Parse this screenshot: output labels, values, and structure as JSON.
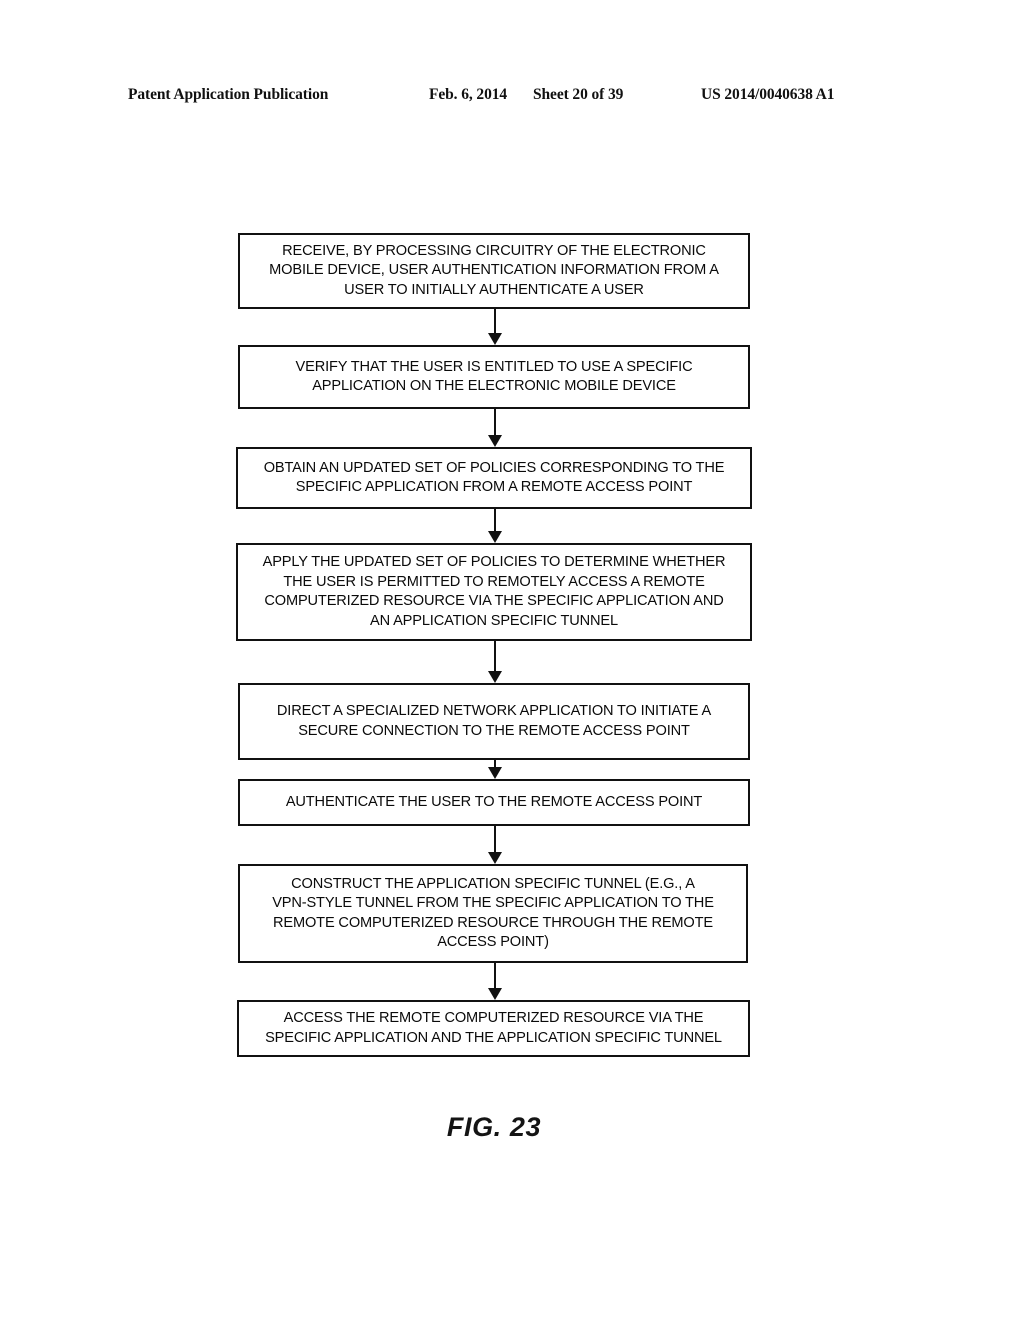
{
  "header": {
    "publication": "Patent Application Publication",
    "date": "Feb. 6, 2014",
    "sheet": "Sheet 20 of 39",
    "document_number": "US 2014/0040638 A1"
  },
  "figure": {
    "caption": "FIG. 23",
    "type": "flowchart",
    "orientation": "vertical-top-to-bottom"
  },
  "flowchart": {
    "steps": [
      {
        "id": "step-receive-authentication-info",
        "text": "RECEIVE, BY PROCESSING CIRCUITRY OF THE ELECTRONIC\nMOBILE DEVICE, USER AUTHENTICATION INFORMATION FROM A\nUSER TO INITIALLY AUTHENTICATE A USER"
      },
      {
        "id": "step-verify-entitlement",
        "text": "VERIFY THAT THE USER IS ENTITLED TO USE A SPECIFIC\nAPPLICATION ON THE ELECTRONIC MOBILE DEVICE"
      },
      {
        "id": "step-obtain-updated-policies",
        "text": "OBTAIN AN UPDATED SET OF POLICIES CORRESPONDING TO THE\nSPECIFIC APPLICATION FROM A REMOTE ACCESS POINT"
      },
      {
        "id": "step-apply-policies",
        "text": "APPLY THE UPDATED SET OF POLICIES TO DETERMINE WHETHER\nTHE USER IS PERMITTED TO REMOTELY ACCESS A REMOTE\nCOMPUTERIZED RESOURCE VIA THE SPECIFIC APPLICATION AND\nAN APPLICATION SPECIFIC TUNNEL"
      },
      {
        "id": "step-direct-network-application",
        "text": "DIRECT A SPECIALIZED NETWORK APPLICATION TO INITIATE A\nSECURE CONNECTION TO THE REMOTE ACCESS POINT"
      },
      {
        "id": "step-authenticate-to-access-point",
        "text": "AUTHENTICATE THE USER TO THE REMOTE ACCESS POINT"
      },
      {
        "id": "step-construct-tunnel",
        "text": "CONSTRUCT THE APPLICATION SPECIFIC TUNNEL (E.G., A\nVPN-STYLE TUNNEL FROM THE SPECIFIC APPLICATION TO THE\nREMOTE COMPUTERIZED RESOURCE THROUGH THE REMOTE\nACCESS POINT)"
      },
      {
        "id": "step-access-resource",
        "text": "ACCESS THE REMOTE COMPUTERIZED RESOURCE VIA THE\nSPECIFIC APPLICATION AND THE APPLICATION SPECIFIC TUNNEL"
      }
    ],
    "connectors": [
      {
        "id": "arrow-1",
        "from": "step-receive-authentication-info",
        "to": "step-verify-entitlement"
      },
      {
        "id": "arrow-2",
        "from": "step-verify-entitlement",
        "to": "step-obtain-updated-policies"
      },
      {
        "id": "arrow-3",
        "from": "step-obtain-updated-policies",
        "to": "step-apply-policies"
      },
      {
        "id": "arrow-4",
        "from": "step-apply-policies",
        "to": "step-direct-network-application"
      },
      {
        "id": "arrow-5",
        "from": "step-direct-network-application",
        "to": "step-authenticate-to-access-point"
      },
      {
        "id": "arrow-6",
        "from": "step-authenticate-to-access-point",
        "to": "step-construct-tunnel"
      },
      {
        "id": "arrow-7",
        "from": "step-construct-tunnel",
        "to": "step-access-resource"
      }
    ]
  },
  "colors": {
    "page_background": "#ffffff",
    "ink": "#111111",
    "text": "#0a0a0a"
  }
}
